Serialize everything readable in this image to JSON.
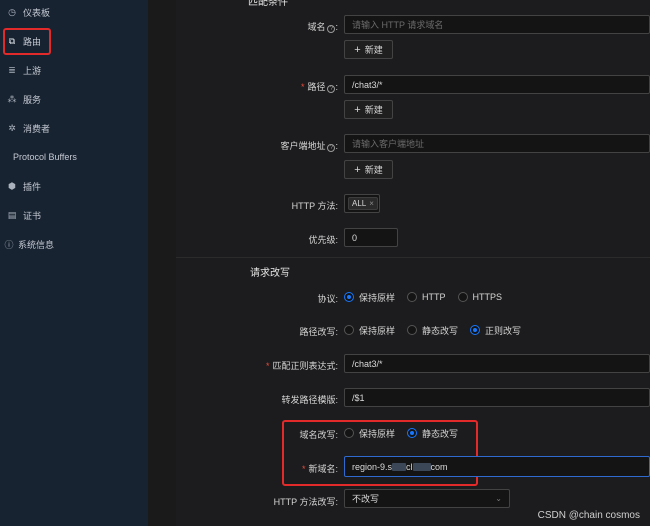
{
  "sidebar": {
    "items": [
      {
        "label": "仪表板",
        "icon": "dashboard-icon",
        "glyph": "◷"
      },
      {
        "label": "路由",
        "icon": "route-icon",
        "glyph": "⧉"
      },
      {
        "label": "上游",
        "icon": "upstream-icon",
        "glyph": "≣"
      },
      {
        "label": "服务",
        "icon": "service-icon",
        "glyph": "⁂"
      },
      {
        "label": "消费者",
        "icon": "consumer-icon",
        "glyph": "✲"
      },
      {
        "label": "Protocol Buffers",
        "icon": "protobuf-icon",
        "glyph": ""
      },
      {
        "label": "插件",
        "icon": "plugin-icon",
        "glyph": "⬢"
      },
      {
        "label": "证书",
        "icon": "certificate-icon",
        "glyph": "▤"
      },
      {
        "label": "系统信息",
        "icon": "info-icon",
        "glyph": "ⓘ"
      }
    ]
  },
  "match": {
    "section_title": "匹配条件",
    "host_label": "域名",
    "host_placeholder": "请输入 HTTP 请求域名",
    "new_label": "新建",
    "path_label": "路径",
    "path_value": "/chat3/*",
    "remote_label": "客户端地址",
    "remote_placeholder": "请输入客户端地址",
    "method_label": "HTTP 方法:",
    "method_tag": "ALL",
    "priority_label": "优先级:",
    "priority_value": "0"
  },
  "rewrite": {
    "section_title": "请求改写",
    "protocol_label": "协议:",
    "protocol_options": [
      "保持原样",
      "HTTP",
      "HTTPS"
    ],
    "path_rewrite_label": "路径改写:",
    "path_rewrite_options": [
      "保持原样",
      "静态改写",
      "正则改写"
    ],
    "regex_label": "匹配正则表达式:",
    "regex_value": "/chat3/*",
    "template_label": "转发路径模版:",
    "template_value": "/$1",
    "host_rewrite_label": "域名改写:",
    "host_rewrite_options": [
      "保持原样",
      "静态改写"
    ],
    "new_host_label": "新域名:",
    "new_host_prefix": "region-9.s",
    "new_host_mid": "cl",
    "new_host_suffix": "com",
    "method_rewrite_label": "HTTP 方法改写:",
    "method_rewrite_value": "不改写"
  },
  "watermark": "CSDN @chain cosmos",
  "colors": {
    "accent": "#1777ff",
    "highlight": "#e22a2a",
    "sidebar": "#182331"
  }
}
